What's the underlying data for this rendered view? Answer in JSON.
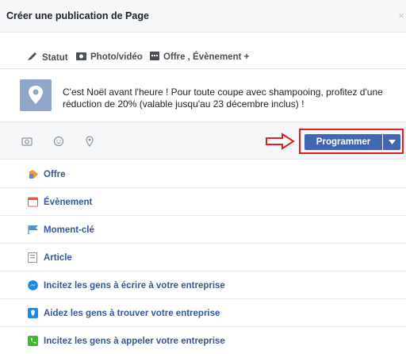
{
  "header": {
    "title": "Créer une publication de Page",
    "close_label": "×"
  },
  "tabs": [
    {
      "label": "Statut",
      "icon": "pencil-icon"
    },
    {
      "label": "Photo/vidéo",
      "icon": "camera-icon"
    },
    {
      "label": "Offre , Évènement +",
      "icon": "calendar-icon"
    }
  ],
  "composer": {
    "text": "C'est Noël avant l'heure ! Pour toute coupe avec shampooing, profitez d'une réduction de 20% (valable jusqu'au 23 décembre inclus) !"
  },
  "actions": {
    "icons": [
      "camera-icon",
      "smiley-icon",
      "location-icon"
    ],
    "schedule_label": "Programmer"
  },
  "options": [
    {
      "label": "Offre",
      "icon": "offer-icon",
      "color": "#f7923b"
    },
    {
      "label": "Évènement",
      "icon": "calendar-icon",
      "color": "#e9573f"
    },
    {
      "label": "Moment-clé",
      "icon": "flag-icon",
      "color": "#4e8fd6"
    },
    {
      "label": "Article",
      "icon": "article-icon",
      "color": "#8d949e"
    },
    {
      "label": "Incitez les gens à écrire à votre entreprise",
      "icon": "messenger-icon",
      "color": "#1e88e5"
    },
    {
      "label": "Aidez les gens à trouver votre entreprise",
      "icon": "map-pin-icon",
      "color": "#1e88e5"
    },
    {
      "label": "Incitez les gens à appeler votre entreprise",
      "icon": "phone-icon",
      "color": "#42b72a"
    }
  ],
  "colors": {
    "primary": "#4267b2",
    "link": "#365899",
    "highlight": "#e02020"
  }
}
